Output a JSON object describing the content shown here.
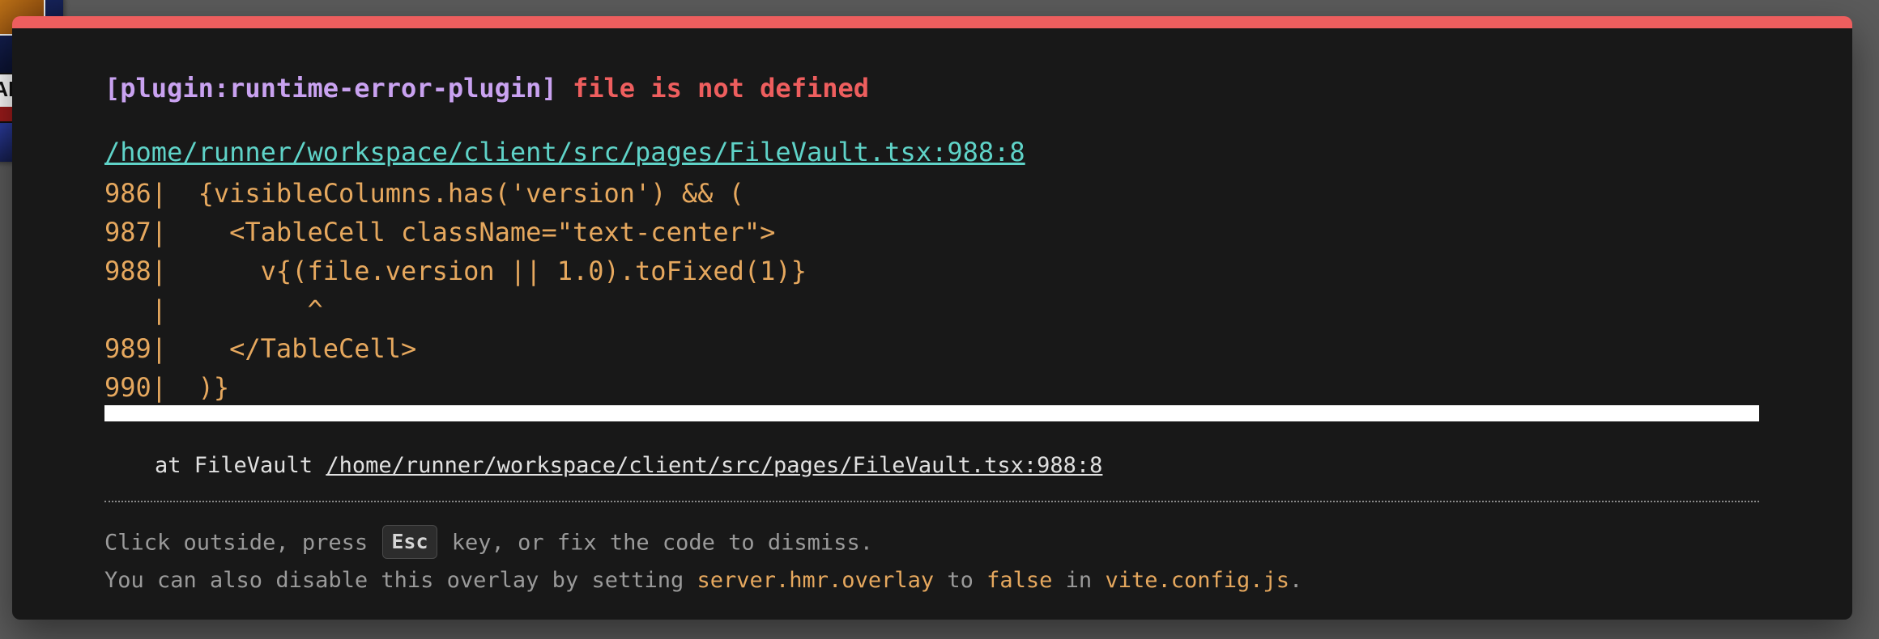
{
  "overlay": {
    "plugin_tag": "[plugin:runtime-error-plugin]",
    "error_message": "file is not defined",
    "file_link": "/home/runner/workspace/client/src/pages/FileVault.tsx:988:8",
    "code_frame": [
      "986|  {visibleColumns.has('version') && (",
      "987|    <TableCell className=\"text-center\">",
      "988|      v{(file.version || 1.0).toFixed(1)}",
      "   |         ^",
      "989|    </TableCell>",
      "990|  )}"
    ],
    "stack": {
      "prefix": "at FileVault ",
      "link": "/home/runner/workspace/client/src/pages/FileVault.tsx:988:8"
    },
    "tip": {
      "line1_before": "Click outside, press ",
      "key": "Esc",
      "line1_after": " key, or fix the code to dismiss.",
      "line2_part1": "You can also disable this overlay by setting ",
      "setting": "server.hmr.overlay",
      "line2_part2": " to ",
      "value": "false",
      "line2_part3": " in ",
      "config_file": "vite.config.js",
      "line2_end": "."
    }
  },
  "background_thumbnail": {
    "label": "AL"
  },
  "colors": {
    "accent_red": "#ee5e5e",
    "plugin_purple": "#c9a2f0",
    "link_teal": "#5fd3c8",
    "code_orange": "#e6a85e",
    "overlay_bg": "#181818"
  }
}
